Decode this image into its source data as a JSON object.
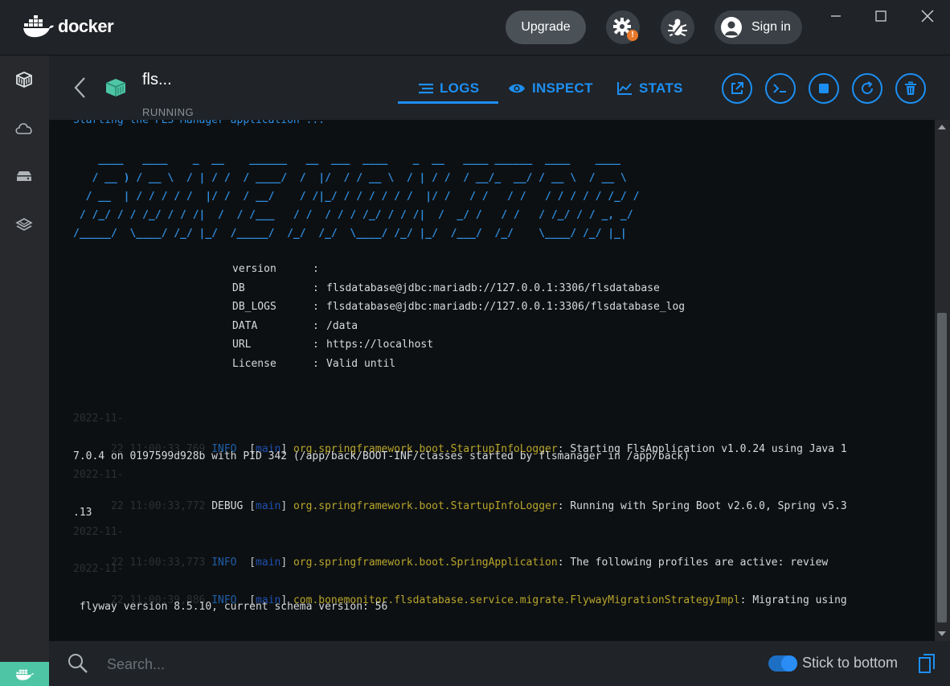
{
  "app": {
    "name": "docker",
    "upgrade_label": "Upgrade",
    "signin_label": "Sign in",
    "settings_badge": "!"
  },
  "container": {
    "name": "fls...",
    "status": "RUNNING"
  },
  "tabs": [
    {
      "label": "LOGS",
      "icon": "logs-icon",
      "active": true
    },
    {
      "label": "INSPECT",
      "icon": "eye-icon",
      "active": false
    },
    {
      "label": "STATS",
      "icon": "stats-icon",
      "active": false
    }
  ],
  "logs": {
    "top_line": "Starting the FLS Manager application ...",
    "banner": [
      "    ____   ____    _  __    ______   __  ___  ____    _  __   ____ ______  ____    ____",
      "   / __ ) / __ \\  / | / /  / ____/  /  |/  / / __ \\  / | / /  / __/_  __/ / __ \\  / __ \\",
      "  / __  | / / / / /  |/ /  / __/    / /|_/ / / / / / /  |/ /   / /   / /   / / / / / /_/ /",
      " / /_/ / / /_/ / / /|  /  / /___   / /  / / / /_/ / / /|  /  _/ /   / /   / /_/ / / _, _/",
      "/_____/  \\____/ /_/ |_/  /_____/  /_/  /_/  \\____/ /_/ |_/  /___/  /_/    \\____/ /_/ |_|"
    ],
    "info": [
      {
        "key": "version",
        "value": ""
      },
      {
        "key": "DB",
        "value": "flsdatabase@jdbc:mariadb://127.0.0.1:3306/flsdatabase"
      },
      {
        "key": "DB_LOGS",
        "value": "flsdatabase@jdbc:mariadb://127.0.0.1:3306/flsdatabase_log"
      },
      {
        "key": "DATA",
        "value": "/data"
      },
      {
        "key": "URL",
        "value": "https://localhost"
      },
      {
        "key": "License",
        "value": "Valid until"
      }
    ],
    "entries": [
      {
        "date": "2022-11-",
        "time": "22 11:00:33,769",
        "level": "INFO ",
        "thread": "main",
        "logger": "org.springframework.boot.StartupInfoLogger",
        "msg1": ": Starting FlsApplication v1.0.24 using Java 1",
        "msg2": "7.0.4 on 0197599d928b with PID 342 (/app/back/BOOT-INF/classes started by flsmanager in /app/back)"
      },
      {
        "date": "2022-11-",
        "time": "22 11:00:33,772",
        "level": "DEBUG",
        "thread": "main",
        "logger": "org.springframework.boot.StartupInfoLogger",
        "msg1": ": Running with Spring Boot v2.6.0, Spring v5.3",
        "msg2": ".13"
      },
      {
        "date": "2022-11-",
        "time": "22 11:00:33,773",
        "level": "INFO ",
        "thread": "main",
        "logger": "org.springframework.boot.SpringApplication",
        "msg1": ": The following profiles are active: review",
        "msg2": ""
      },
      {
        "date": "2022-11-",
        "time": "22 11:00:39,886",
        "level": "INFO ",
        "thread": "main",
        "logger": "com.bonemonitor.flsdatabase.service.migrate.FlywayMigrationStrategyImpl",
        "msg1": ": Migrating using",
        "msg2": " flyway version 8.5.10, current schema version: 56"
      }
    ]
  },
  "bottom": {
    "search_placeholder": "Search...",
    "stick_label": "Stick to bottom"
  },
  "colors": {
    "accent": "#1d8ff3",
    "container_icon": "#4ec6a6",
    "log_bg": "#0d1012"
  }
}
